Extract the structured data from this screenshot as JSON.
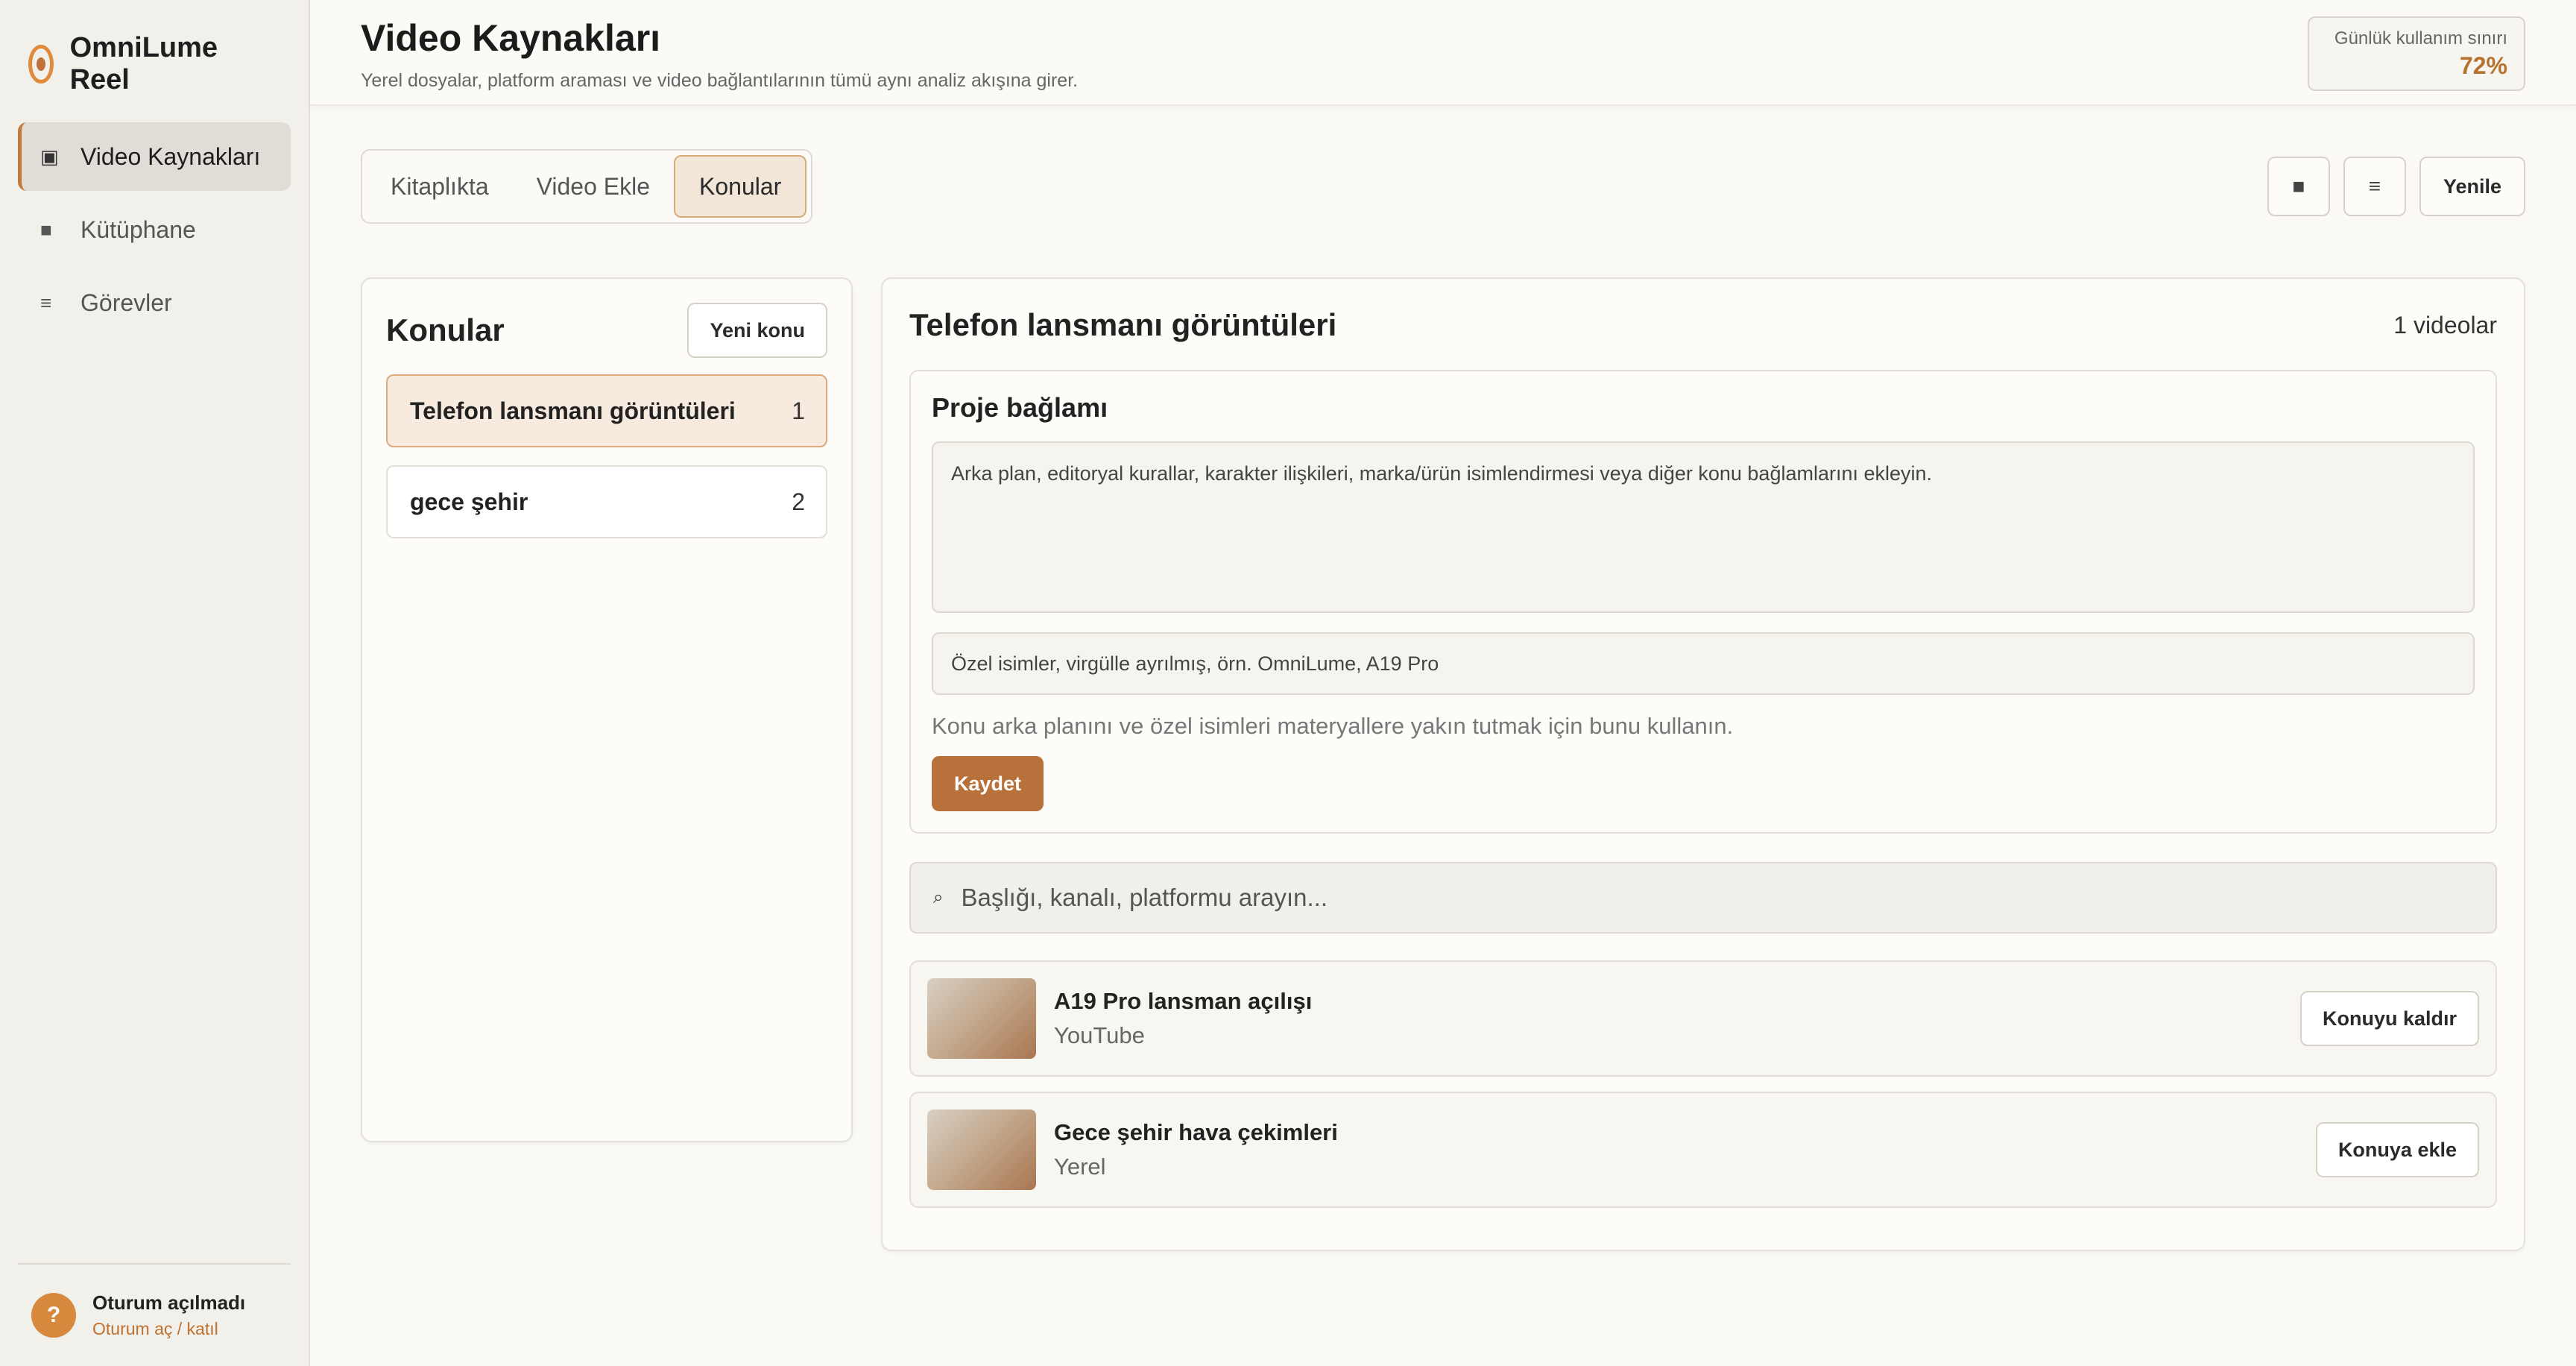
{
  "sidebar": {
    "brand": "OmniLume Reel",
    "items": [
      {
        "label": "Video Kaynakları",
        "icon": "▣"
      },
      {
        "label": "Kütüphane",
        "icon": "■"
      },
      {
        "label": "Görevler",
        "icon": "≡"
      }
    ],
    "account": {
      "avatar": "?",
      "name": "Oturum açılmadı",
      "link": "Oturum aç / katıl"
    }
  },
  "header": {
    "title": "Video Kaynakları",
    "subtitle": "Yerel dosyalar, platform araması ve video bağlantılarının tümü aynı analiz akışına girer.",
    "usage_label": "Günlük kullanım sınırı",
    "usage_value": "72%"
  },
  "toolbar": {
    "tabs": [
      "Kitaplıkta",
      "Video Ekle",
      "Konular"
    ],
    "active_tab": "Konular",
    "grid_icon": "■",
    "list_icon": "≡",
    "refresh_label": "Yenile"
  },
  "topics": {
    "title": "Konular",
    "new_label": "Yeni konu",
    "items": [
      {
        "name": "Telefon lansmanı görüntüleri",
        "count": "1"
      },
      {
        "name": "gece şehir",
        "count": "2"
      }
    ]
  },
  "detail": {
    "title": "Telefon lansmanı görüntüleri",
    "count": "1 videolar",
    "context_title": "Proje bağlamı",
    "context_placeholder": "Arka plan, editoryal kurallar, karakter ilişkileri, marka/ürün isimlendirmesi veya diğer konu bağlamlarını ekleyin.",
    "names_placeholder": "Özel isimler, virgülle ayrılmış, örn. OmniLume, A19 Pro",
    "hint": "Konu arka planını ve özel isimleri materyallere yakın tutmak için bunu kullanın.",
    "save_label": "Kaydet",
    "search_icon": "⌕",
    "search_placeholder": "Başlığı, kanalı, platformu arayın...",
    "videos": [
      {
        "title": "A19 Pro lansman açılışı",
        "source": "YouTube",
        "action": "Konuyu kaldır"
      },
      {
        "title": "Gece şehir hava çekimleri",
        "source": "Yerel",
        "action": "Konuya ekle"
      }
    ]
  }
}
